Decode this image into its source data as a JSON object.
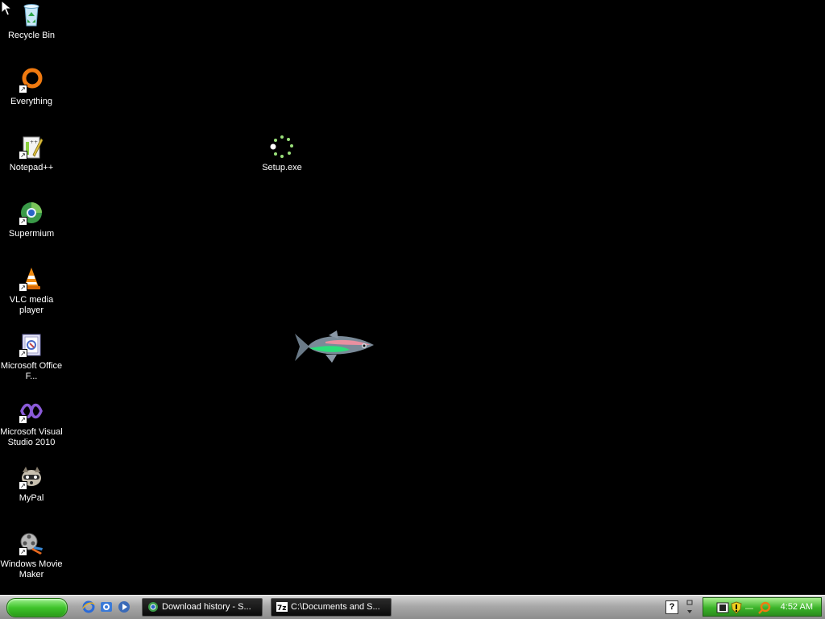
{
  "desktop": {
    "icons": [
      {
        "label": "Recycle Bin",
        "icon": "recycle-bin-icon"
      },
      {
        "label": "Everything",
        "icon": "everything-search-icon"
      },
      {
        "label": "Notepad++",
        "icon": "notepad-plus-plus-icon"
      },
      {
        "label": "Supermium",
        "icon": "supermium-browser-icon"
      },
      {
        "label": "VLC media player",
        "icon": "vlc-cone-icon"
      },
      {
        "label": "Microsoft Office F...",
        "icon": "office-document-icon"
      },
      {
        "label": "Microsoft Visual Studio 2010",
        "icon": "visual-studio-icon"
      },
      {
        "label": "MyPal",
        "icon": "mypal-raccoon-icon"
      },
      {
        "label": "Windows Movie Maker",
        "icon": "movie-maker-icon"
      },
      {
        "label": "Setup.exe",
        "icon": "setup-spinner-icon"
      }
    ]
  },
  "taskbar": {
    "tasks": [
      {
        "label": "Download history - S...",
        "icon": "browser-icon"
      },
      {
        "label": "C:\\Documents and S...",
        "icon": "7zip-icon"
      }
    ],
    "clock": "4:52 AM"
  },
  "colors": {
    "desktop_background": "#000000",
    "taskbar": "#a8a8a8",
    "start_button": "#3fc42b",
    "tray": "#3cb42a"
  }
}
